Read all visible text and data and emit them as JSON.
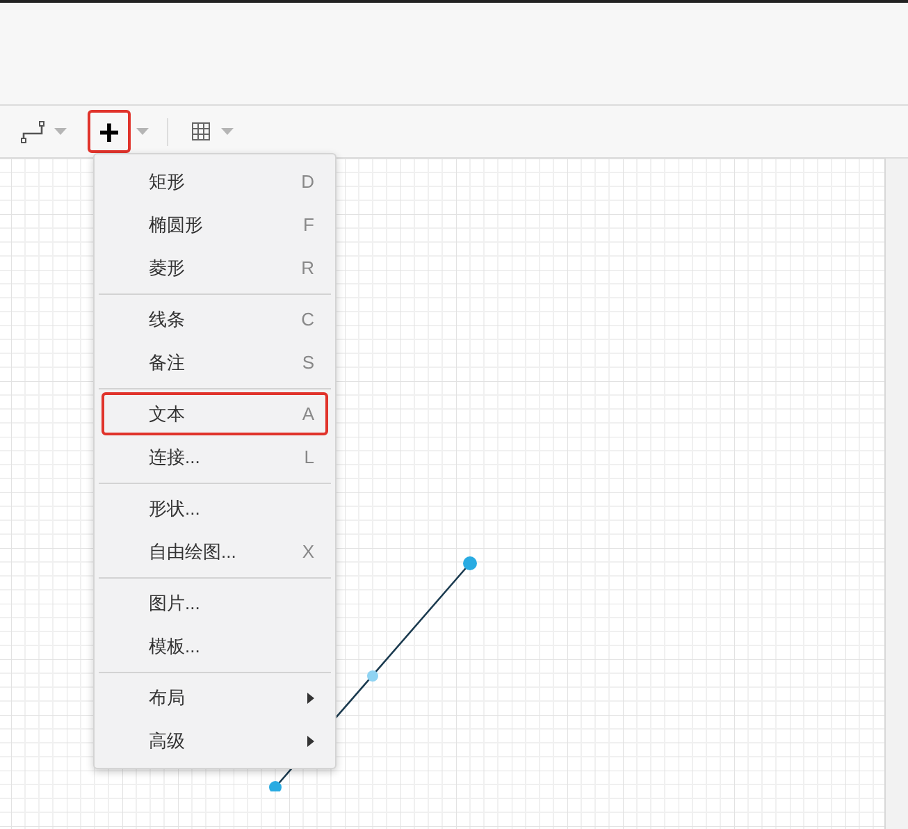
{
  "toolbar": {
    "buttons": [
      {
        "kind": "connector",
        "highlighted": false
      },
      {
        "kind": "insert",
        "label": "+",
        "highlighted": true
      },
      {
        "kind": "table",
        "highlighted": false
      }
    ]
  },
  "menu": {
    "groups": [
      [
        {
          "label": "矩形",
          "shortcut": "D",
          "submenu": false,
          "highlighted": false
        },
        {
          "label": "椭圆形",
          "shortcut": "F",
          "submenu": false,
          "highlighted": false
        },
        {
          "label": "菱形",
          "shortcut": "R",
          "submenu": false,
          "highlighted": false
        }
      ],
      [
        {
          "label": "线条",
          "shortcut": "C",
          "submenu": false,
          "highlighted": false
        },
        {
          "label": "备注",
          "shortcut": "S",
          "submenu": false,
          "highlighted": false
        }
      ],
      [
        {
          "label": "文本",
          "shortcut": "A",
          "submenu": false,
          "highlighted": true
        },
        {
          "label": "连接...",
          "shortcut": "L",
          "submenu": false,
          "highlighted": false
        }
      ],
      [
        {
          "label": "形状...",
          "submenu": false,
          "highlighted": false
        },
        {
          "label": "自由绘图...",
          "shortcut": "X",
          "submenu": false,
          "highlighted": false
        }
      ],
      [
        {
          "label": "图片...",
          "submenu": false,
          "highlighted": false
        },
        {
          "label": "模板...",
          "submenu": false,
          "highlighted": false
        }
      ],
      [
        {
          "label": "布局",
          "submenu": true,
          "highlighted": false
        },
        {
          "label": "高级",
          "submenu": true,
          "highlighted": false
        }
      ]
    ]
  }
}
